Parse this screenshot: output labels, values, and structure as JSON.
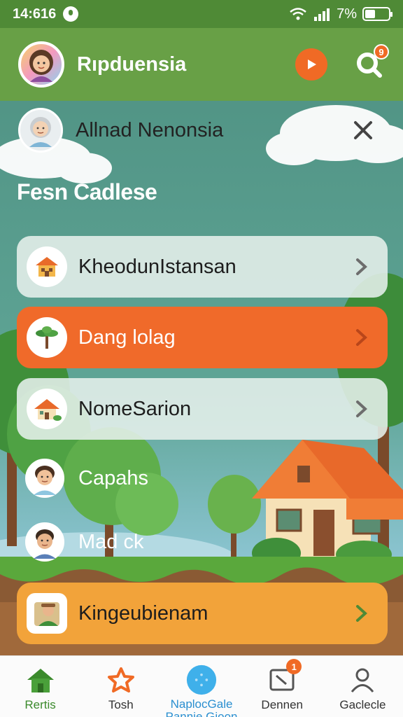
{
  "status_bar": {
    "time": "14:616",
    "battery": "7%"
  },
  "app_bar": {
    "title": "Rıpduensia",
    "search_badge": "9"
  },
  "pinned": {
    "name": "Allnad Nenonsia"
  },
  "section": {
    "title": "Fesn Cadlese"
  },
  "cards": [
    {
      "label": "KheodunIstansan",
      "style": "light",
      "icon": "house-icon"
    },
    {
      "label": "Dang lolag",
      "style": "orange",
      "icon": "palm-tree-icon"
    },
    {
      "label": "NomeSarion",
      "style": "light",
      "icon": "cottage-icon"
    }
  ],
  "plain_rows": [
    {
      "label": "Capahs",
      "icon": "boy-avatar-icon"
    },
    {
      "label": "Mad ck",
      "icon": "man-avatar-icon"
    }
  ],
  "bottom_card": {
    "label": "Kingeubienam",
    "icon": "farmer-avatar-icon"
  },
  "bottom_nav": [
    {
      "label": "Rertis",
      "icon": "home-icon",
      "active": true
    },
    {
      "label": "Tosh",
      "icon": "star-icon"
    },
    {
      "label": "NaplocGale",
      "sublabel": "Pannie Gioon",
      "icon": "globe-icon"
    },
    {
      "label": "Dennen",
      "icon": "message-icon",
      "badge": "1"
    },
    {
      "label": "Gaclecle",
      "icon": "profile-icon"
    }
  ],
  "colors": {
    "status_bar": "#4f8a36",
    "app_bar": "#68a046",
    "accent_orange": "#f06a2a",
    "accent_amber": "#f2a33a",
    "sky_teal": "#5e9b86",
    "nav_active": "#3b8a2c"
  }
}
